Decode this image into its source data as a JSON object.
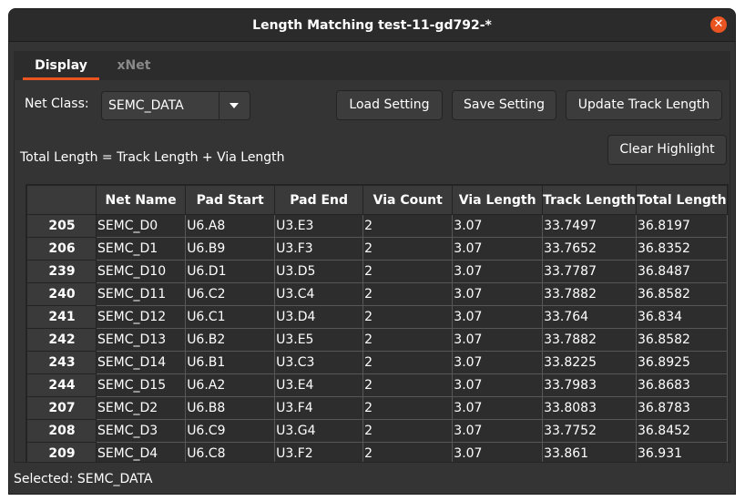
{
  "window": {
    "title": "Length Matching test-11-gd792-*"
  },
  "tabs": [
    {
      "label": "Display"
    },
    {
      "label": "xNet"
    }
  ],
  "netclass": {
    "label": "Net Class:",
    "value": "SEMC_DATA"
  },
  "buttons": {
    "load": "Load Setting",
    "save": "Save Setting",
    "update": "Update Track Length",
    "clear": "Clear Highlight"
  },
  "formula": "Total Length = Track Length + Via Length",
  "table": {
    "headers": [
      "",
      "Net Name",
      "Pad Start",
      "Pad End",
      "Via Count",
      "Via Length",
      "Track Length",
      "Total Length"
    ],
    "rows": [
      [
        "205",
        "SEMC_D0",
        "U6.A8",
        "U3.E3",
        "2",
        "3.07",
        "33.7497",
        "36.8197"
      ],
      [
        "206",
        "SEMC_D1",
        "U6.B9",
        "U3.F3",
        "2",
        "3.07",
        "33.7652",
        "36.8352"
      ],
      [
        "239",
        "SEMC_D10",
        "U6.D1",
        "U3.D5",
        "2",
        "3.07",
        "33.7787",
        "36.8487"
      ],
      [
        "240",
        "SEMC_D11",
        "U6.C2",
        "U3.C4",
        "2",
        "3.07",
        "33.7882",
        "36.8582"
      ],
      [
        "241",
        "SEMC_D12",
        "U6.C1",
        "U3.D4",
        "2",
        "3.07",
        "33.764",
        "36.834"
      ],
      [
        "242",
        "SEMC_D13",
        "U6.B2",
        "U3.E5",
        "2",
        "3.07",
        "33.7882",
        "36.8582"
      ],
      [
        "243",
        "SEMC_D14",
        "U6.B1",
        "U3.C3",
        "2",
        "3.07",
        "33.8225",
        "36.8925"
      ],
      [
        "244",
        "SEMC_D15",
        "U6.A2",
        "U3.E4",
        "2",
        "3.07",
        "33.7983",
        "36.8683"
      ],
      [
        "207",
        "SEMC_D2",
        "U6.B8",
        "U3.F4",
        "2",
        "3.07",
        "33.8083",
        "36.8783"
      ],
      [
        "208",
        "SEMC_D3",
        "U6.C9",
        "U3.G4",
        "2",
        "3.07",
        "33.7752",
        "36.8452"
      ],
      [
        "209",
        "SEMC_D4",
        "U6.C8",
        "U3.F2",
        "2",
        "3.07",
        "33.861",
        "36.931"
      ]
    ]
  },
  "status": "Selected: SEMC_DATA",
  "colors": {
    "accent": "#e95420",
    "window_bg": "#343434",
    "table_bg": "#2d2d2d"
  },
  "icons": {
    "close": "close-icon",
    "dropdown": "chevron-down-icon"
  }
}
